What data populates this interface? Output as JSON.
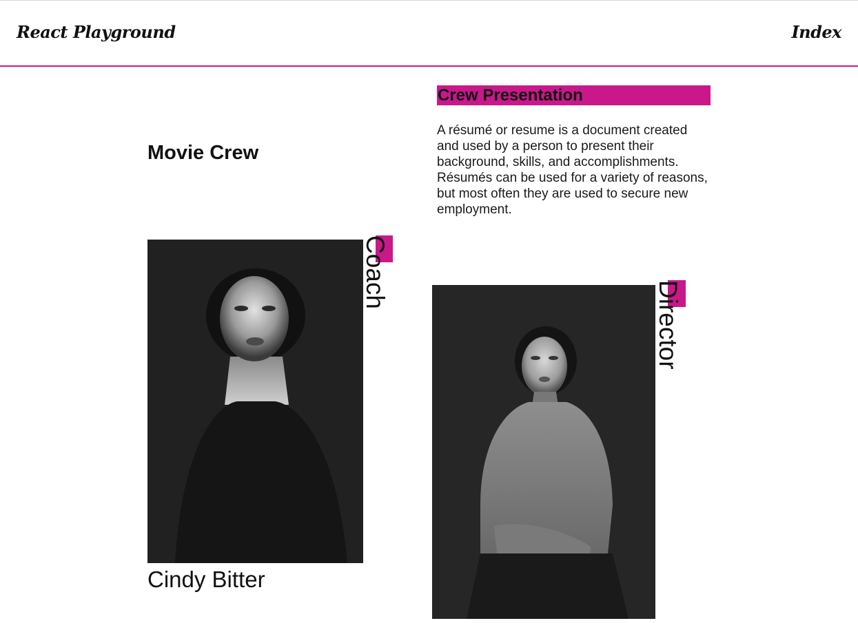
{
  "header": {
    "brand": "React Playground",
    "nav_link": "Index"
  },
  "main": {
    "section_title": "Movie Crew",
    "intro": {
      "heading": "Crew Presentation",
      "text": "A résumé or resume is a document created and used by a person to present their background, skills, and accomplishments. Résumés can be used for a variety of reasons, but most often they are used to secure new employment."
    },
    "crew": [
      {
        "role": "Coach",
        "name": "Cindy Bitter"
      },
      {
        "role": "Director"
      }
    ]
  },
  "colors": {
    "accent": "#c8188a",
    "text": "#111111",
    "photo_background": "#212121"
  }
}
